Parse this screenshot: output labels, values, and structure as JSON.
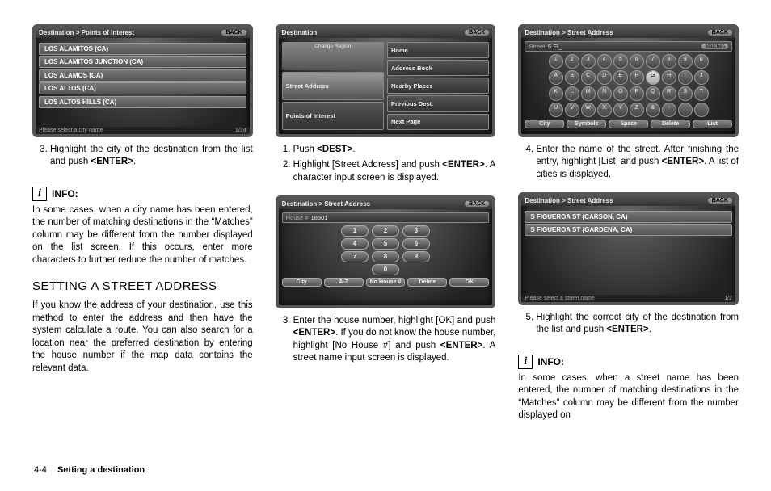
{
  "footer": {
    "page": "4-4",
    "section": "Setting a destination"
  },
  "col1": {
    "shot1": {
      "crumb": "Destination > Points of Interest",
      "back": "BACK",
      "rows": [
        "LOS ALAMITOS (CA)",
        "LOS ALAMITOS JUNCTION (CA)",
        "LOS ALAMOS (CA)",
        "LOS ALTOS (CA)",
        "LOS ALTOS HILLS (CA)"
      ],
      "hint": "Please select a city name",
      "counter": "1/24"
    },
    "step3": "Highlight the city of the destination from the list and push <ENTER>.",
    "info_label": "INFO:",
    "info_body": "In some cases, when a city name has been entered, the number of matching destinations in the “Matches” column may be different from the number displayed on the list screen. If this occurs, enter more characters to further reduce the number of matches.",
    "heading": "SETTING A STREET ADDRESS",
    "body": "If you know the address of your destination, use this method to enter the address and then have the system calculate a route. You can also search for a location near the preferred destination by entering the house number if the map data contains the relevant data."
  },
  "col2": {
    "shotA": {
      "crumb": "Destination",
      "back": "BACK",
      "region_label": "Change Region",
      "left": [
        "Street Address",
        "Points of Interest"
      ],
      "right": [
        "Home",
        "Address Book",
        "Nearby Places",
        "Previous Dest.",
        "Next Page"
      ]
    },
    "step1": "Push <DEST>.",
    "step2": "Highlight [Street Address] and push <ENTER>. A character input screen is displayed.",
    "shotB": {
      "crumb": "Destination > Street Address",
      "back": "BACK",
      "field_label": "House #",
      "field_value": "18501",
      "keys": [
        [
          "1",
          "2",
          "3"
        ],
        [
          "4",
          "5",
          "6"
        ],
        [
          "7",
          "8",
          "9"
        ],
        [
          "0"
        ]
      ],
      "btns": [
        "City",
        "A-Z",
        "No House #",
        "Delete",
        "OK"
      ]
    },
    "step3": "Enter the house number, highlight [OK] and push <ENTER>. If you do not know the house number, highlight [No House #] and push <ENTER>. A street name input screen is displayed."
  },
  "col3": {
    "shotA": {
      "crumb": "Destination > Street Address",
      "back": "BACK",
      "field_label": "Street",
      "field_value": "S FI_",
      "matches_label": "Matches",
      "rows": [
        [
          "1",
          "2",
          "3",
          "4",
          "5",
          "6",
          "7",
          "8",
          "9",
          "0"
        ],
        [
          "A",
          "B",
          "C",
          "D",
          "E",
          "F",
          "G",
          "H",
          "I",
          "J"
        ],
        [
          "K",
          "L",
          "M",
          "N",
          "O",
          "P",
          "Q",
          "R",
          "S",
          "T"
        ],
        [
          "U",
          "V",
          "W",
          "X",
          "Y",
          "Z",
          "&",
          "-",
          "",
          ""
        ]
      ],
      "sel": "G",
      "btns": [
        "City",
        "Symbols",
        "Space",
        "Delete",
        "List"
      ]
    },
    "step4": "Enter the name of the street. After finishing the entry, highlight [List] and push <ENTER>. A list of cities is displayed.",
    "shotB": {
      "crumb": "Destination > Street Address",
      "back": "BACK",
      "rows": [
        "S FIGUEROA ST (CARSON, CA)",
        "S FIGUEROA ST (GARDENA, CA)"
      ],
      "hint": "Please select a street name",
      "counter": "1/2"
    },
    "step5": "Highlight the correct city of the destination from the list and push <ENTER>.",
    "info_label": "INFO:",
    "info_body": "In some cases, when a street name has been entered, the number of matching destinations in the “Matches” column may be different from the number displayed on"
  }
}
